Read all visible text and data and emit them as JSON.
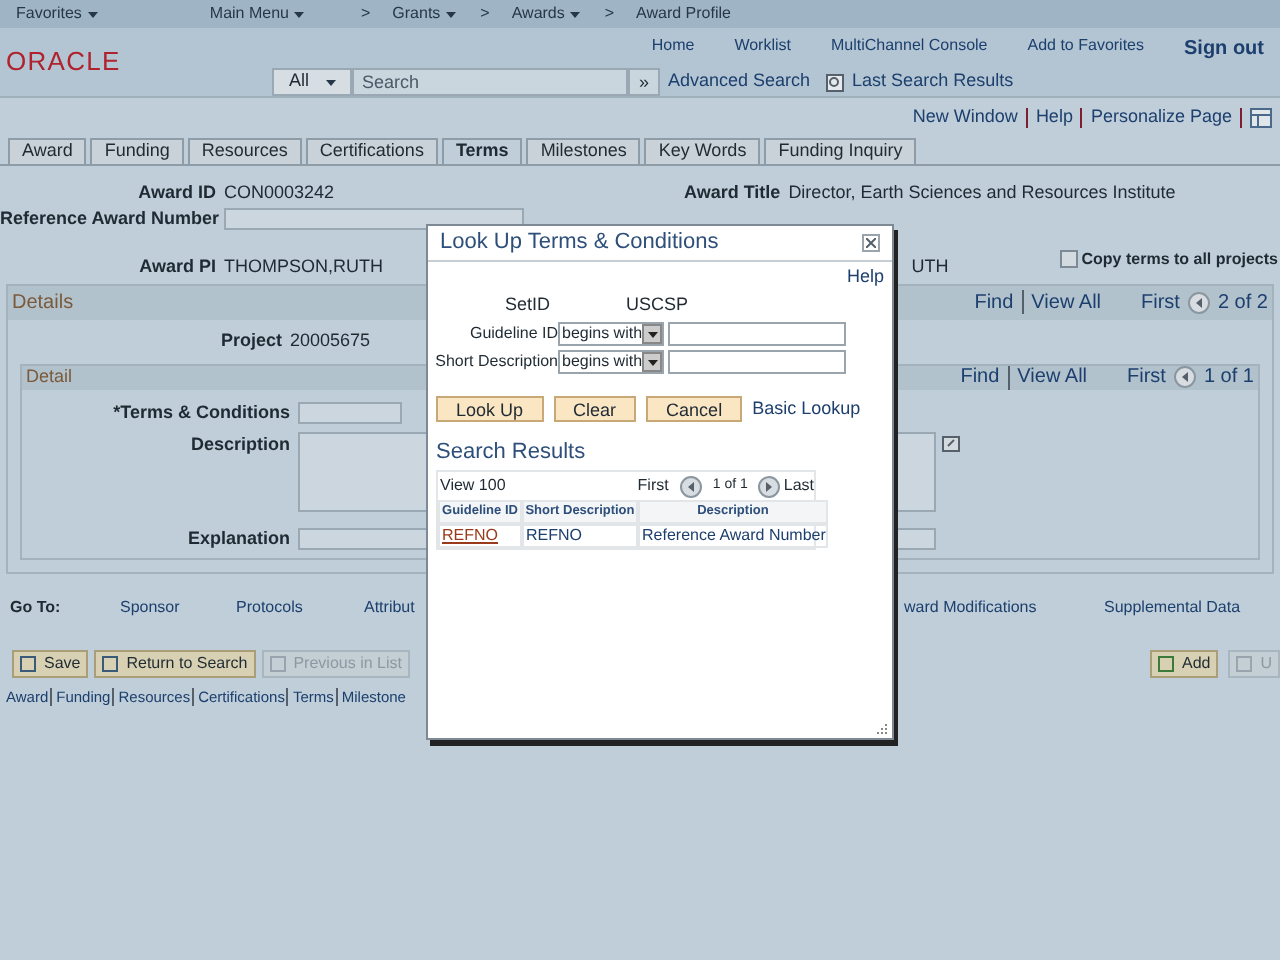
{
  "nav_bar": {
    "separator": ">",
    "items": [
      "Favorites",
      "Main Menu",
      "Grants",
      "Awards",
      "Award Profile"
    ]
  },
  "header": {
    "logo": "ORACLE",
    "links": [
      "Home",
      "Worklist",
      "MultiChannel Console",
      "Add to Favorites",
      "Sign out"
    ],
    "search": {
      "scope": "All",
      "placeholder": "Search",
      "go": "»"
    },
    "advanced_search": "Advanced Search",
    "last_search": "Last Search Results"
  },
  "page_links": [
    "New Window",
    "Help",
    "Personalize Page"
  ],
  "tabs": [
    {
      "label": "Award",
      "selected": false
    },
    {
      "label": "Funding",
      "selected": false
    },
    {
      "label": "Resources",
      "selected": false
    },
    {
      "label": "Certifications",
      "selected": false
    },
    {
      "label": "Terms",
      "selected": true
    },
    {
      "label": "Milestones",
      "selected": false
    },
    {
      "label": "Key Words",
      "selected": false
    },
    {
      "label": "Funding Inquiry",
      "selected": false
    }
  ],
  "award": {
    "id_label": "Award ID",
    "id": "CON0003242",
    "title_label": "Award Title",
    "title": "Director, Earth Sciences and Resources Institute",
    "ref_label": "Reference Award Number",
    "pi_label": "Award PI",
    "pi": "THOMPSON,RUTH",
    "pi_right": "UTH",
    "copy_label": "Copy terms to all projects",
    "copy_checked": false
  },
  "details": {
    "title": "Details",
    "find": "Find",
    "view_all": "View All",
    "first": "First",
    "count": "2 of 2",
    "project_label": "Project",
    "project": "20005675"
  },
  "detail": {
    "title": "Detail",
    "find": "Find",
    "view_all": "View All",
    "first": "First",
    "count": "1 of 1",
    "terms_label": "*Terms & Conditions",
    "description_label": "Description",
    "explanation_label": "Explanation"
  },
  "goto": {
    "label": "Go To:",
    "links": [
      "Sponsor",
      "Protocols",
      "Attribut",
      "ward Modifications",
      "Supplemental Data"
    ]
  },
  "buttons": [
    {
      "label": "Save",
      "disabled": false
    },
    {
      "label": "Return to Search",
      "disabled": false
    },
    {
      "label": "Previous in List",
      "disabled": true
    }
  ],
  "right_buttons": [
    {
      "label": "Add",
      "disabled": false
    },
    {
      "label": "U",
      "disabled": true
    }
  ],
  "bottom_links": [
    "Award",
    "Funding",
    "Resources",
    "Certifications",
    "Terms",
    "Milestone"
  ],
  "dialog": {
    "title": "Look Up Terms & Conditions",
    "help": "Help",
    "setid_label": "SetID",
    "setid": "USCSP",
    "criteria": [
      {
        "label": "Guideline ID",
        "operator": "begins with"
      },
      {
        "label": "Short Description",
        "operator": "begins with"
      }
    ],
    "actions": [
      "Look Up",
      "Clear",
      "Cancel"
    ],
    "basic_lookup": "Basic Lookup",
    "results_title": "Search Results",
    "view": "View 100",
    "first": "First",
    "count": "1 of 1",
    "last": "Last",
    "columns": [
      "Guideline ID",
      "Short Description",
      "Description"
    ],
    "rows": [
      [
        "REFNO",
        "REFNO",
        "Reference Award Number"
      ]
    ]
  }
}
